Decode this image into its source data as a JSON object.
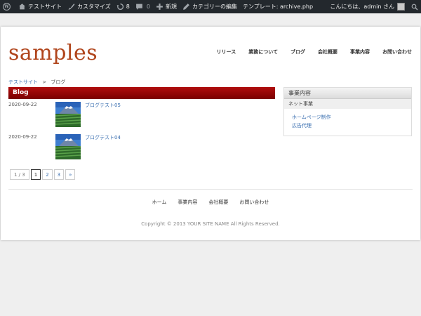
{
  "adminbar": {
    "site": "テストサイト",
    "customize": "カスタマイズ",
    "updates_count": "8",
    "comments_count": "0",
    "new": "新規",
    "edit": "カテゴリーの編集",
    "template": "テンプレート: archive.php",
    "greeting": "こんにちは、admin さん",
    "icons": [
      "wordpress-icon",
      "home-icon",
      "brush-icon",
      "updates-icon",
      "comment-icon",
      "plus-icon",
      "pencil-icon",
      "avatar",
      "search-icon"
    ]
  },
  "header": {
    "logo": "samples",
    "nav": [
      "リリース",
      "業務について",
      "ブログ",
      "会社概要",
      "事業内容",
      "お問い合わせ"
    ]
  },
  "breadcrumb": {
    "home": "テストサイト",
    "sep": ">",
    "current": "ブログ"
  },
  "main": {
    "heading": "Blog",
    "posts": [
      {
        "date": "2020-09-22",
        "title": "ブログテスト05"
      },
      {
        "date": "2020-09-22",
        "title": "ブログテスト04"
      }
    ],
    "pager": {
      "info": "1 / 3",
      "pages": [
        "1",
        "2",
        "3"
      ],
      "next": "»"
    }
  },
  "sidebar": {
    "title": "事業内容",
    "category": "ネット事業",
    "links": [
      "ホームページ制作",
      "広告代理"
    ]
  },
  "footer": {
    "nav": [
      "ホーム",
      "事業内容",
      "会社概要",
      "お問い合わせ"
    ],
    "copyright": "Copyright © 2013 YOUR SITE NAME All Rights Reserved."
  },
  "colors": {
    "accent": "#b0451c",
    "heading_bar": "#9b0a0a",
    "link": "#3a6fb0",
    "adminbar": "#23282d"
  }
}
